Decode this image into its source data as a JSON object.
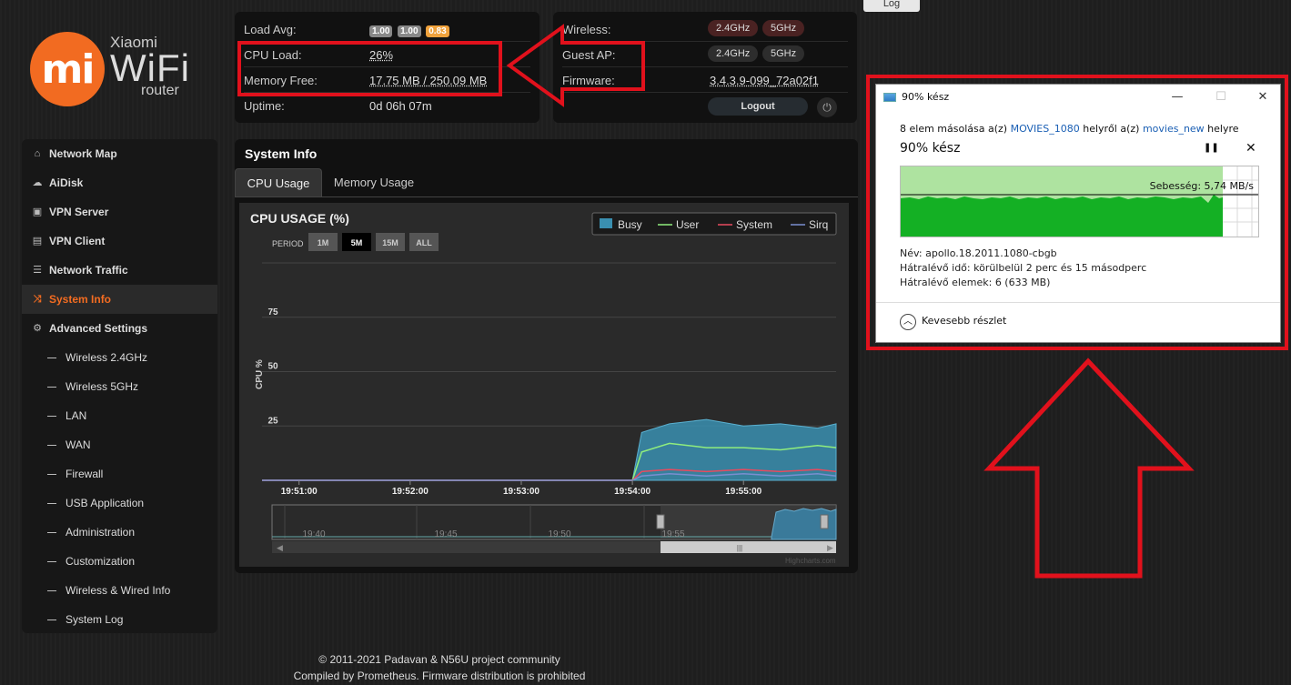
{
  "logo": {
    "mark": "mi",
    "brand": "Xiaomi",
    "product": "WiFi",
    "sub": "router",
    "color": "#f26b21"
  },
  "status_left": {
    "load_avg_label": "Load Avg:",
    "load_avg": [
      "1.00",
      "1.00",
      "0.83"
    ],
    "cpu_label": "CPU Load:",
    "cpu_value": "26%",
    "mem_label": "Memory Free:",
    "mem_value": "17.75 MB / 250.09 MB",
    "uptime_label": "Uptime:",
    "uptime_value": "0d 06h 07m"
  },
  "status_right": {
    "wireless_label": "Wireless:",
    "wireless": [
      "2.4GHz",
      "5GHz"
    ],
    "guest_label": "Guest AP:",
    "guest": [
      "2.4GHz",
      "5GHz"
    ],
    "firmware_label": "Firmware:",
    "firmware_value": "3.4.3.9-099_72a02f1",
    "logout": "Logout"
  },
  "log_tab": "Log",
  "sidebar": {
    "items": [
      {
        "label": "Network Map",
        "icon": "home-icon"
      },
      {
        "label": "AiDisk",
        "icon": "cloud-icon"
      },
      {
        "label": "VPN Server",
        "icon": "vpn-server-icon"
      },
      {
        "label": "VPN Client",
        "icon": "lock-icon"
      },
      {
        "label": "Network Traffic",
        "icon": "list-icon"
      },
      {
        "label": "System Info",
        "icon": "shuffle-icon"
      },
      {
        "label": "Advanced Settings",
        "icon": "gear-icon"
      }
    ],
    "sub_items": [
      "Wireless 2.4GHz",
      "Wireless 5GHz",
      "LAN",
      "WAN",
      "Firewall",
      "USB Application",
      "Administration",
      "Customization",
      "Wireless & Wired Info",
      "System Log"
    ],
    "accent": "#f36c21"
  },
  "sysinfo": {
    "title": "System Info",
    "tabs": [
      "CPU Usage",
      "Memory Usage"
    ]
  },
  "cpu_chart": {
    "title": "CPU USAGE (%)",
    "period_label": "PERIOD",
    "periods": [
      "1M",
      "5M",
      "15M",
      "ALL"
    ],
    "active_period": "5M",
    "legend": [
      "Busy",
      "User",
      "System",
      "Sirq"
    ],
    "y_label": "CPU %",
    "y_ticks": [
      "75",
      "50",
      "25"
    ],
    "x_ticks": [
      "19:51:00",
      "19:52:00",
      "19:53:00",
      "19:54:00",
      "19:55:00"
    ],
    "nav_ticks": [
      "19:40",
      "19:45",
      "19:50",
      "19:55"
    ],
    "credit": "Highcharts.com",
    "colors": {
      "busy": "#3a8fb0",
      "user": "#90ed7d",
      "system": "#e84a5f",
      "sirq": "#7a8ed0"
    }
  },
  "chart_data": {
    "type": "area",
    "title": "CPU USAGE (%)",
    "ylabel": "CPU %",
    "ylim": [
      0,
      100
    ],
    "grid": true,
    "legend_position": "top-right",
    "x_range": [
      "19:50:40",
      "19:55:50"
    ],
    "series": [
      {
        "name": "Busy",
        "x": [
          "19:50:40",
          "19:54:00",
          "19:54:05",
          "19:54:20",
          "19:54:40",
          "19:55:00",
          "19:55:20",
          "19:55:40",
          "19:55:50"
        ],
        "values": [
          0,
          0,
          22,
          26,
          28,
          25,
          26,
          24,
          26
        ]
      },
      {
        "name": "User",
        "x": [
          "19:50:40",
          "19:54:00",
          "19:54:05",
          "19:54:20",
          "19:54:40",
          "19:55:00",
          "19:55:20",
          "19:55:40",
          "19:55:50"
        ],
        "values": [
          0,
          0,
          13,
          17,
          15,
          15,
          14,
          16,
          15
        ]
      },
      {
        "name": "System",
        "x": [
          "19:50:40",
          "19:54:00",
          "19:54:05",
          "19:54:20",
          "19:54:40",
          "19:55:00",
          "19:55:20",
          "19:55:40",
          "19:55:50"
        ],
        "values": [
          0,
          0,
          4,
          5,
          4,
          5,
          4,
          5,
          4
        ]
      },
      {
        "name": "Sirq",
        "x": [
          "19:50:40",
          "19:54:00",
          "19:54:05",
          "19:54:20",
          "19:54:40",
          "19:55:00",
          "19:55:20",
          "19:55:40",
          "19:55:50"
        ],
        "values": [
          0,
          0,
          2,
          3,
          2,
          3,
          2,
          3,
          2
        ]
      }
    ]
  },
  "dialog": {
    "title": "90% kész",
    "line_pre": "8 elem másolása a(z) ",
    "src": "MOVIES_1080",
    "line_mid": " helyről a(z) ",
    "dst": "movies_new",
    "line_post": " helyre",
    "progress_text": "90% kész",
    "progress_fraction": 0.9,
    "speed": "Sebesség: 5,74 MB/s",
    "name_label": "Név:",
    "name_value": "apollo.18.2011.1080-cbgb",
    "time_label": "Hátralévő idő:",
    "time_value": "körülbelül 2 perc és 15 másodperc",
    "items_label": "Hátralévő elemek:",
    "items_value": "6 (633 MB)",
    "less_details": "Kevesebb részlet"
  },
  "footer": {
    "line1": "© 2011-2021 Padavan & N56U project community",
    "line2": "Compiled by Prometheus. Firmware distribution is prohibited"
  },
  "annotation_color": "#e1111c"
}
